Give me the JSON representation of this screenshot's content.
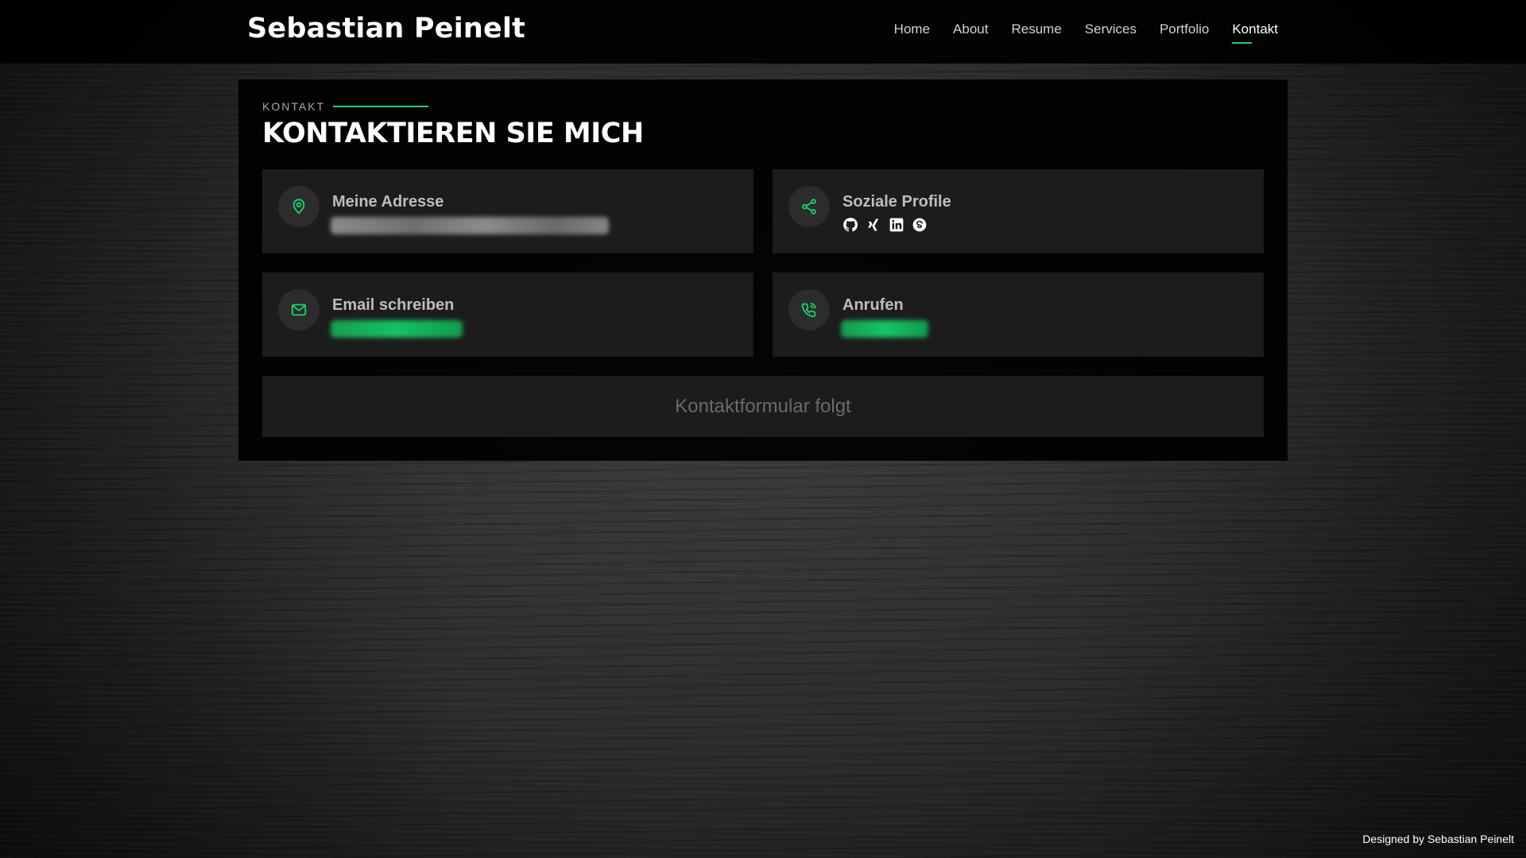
{
  "brand": "Sebastian Peinelt",
  "nav": {
    "items": [
      {
        "label": "Home"
      },
      {
        "label": "About"
      },
      {
        "label": "Resume"
      },
      {
        "label": "Services"
      },
      {
        "label": "Portfolio"
      },
      {
        "label": "Kontakt",
        "active": true
      }
    ]
  },
  "section": {
    "label": "KONTAKT",
    "title": "KONTAKTIEREN SIE MICH"
  },
  "cards": {
    "address": {
      "title": "Meine Adresse",
      "icon": "map-pin-icon",
      "value_state": "blurred"
    },
    "social": {
      "title": "Soziale Profile",
      "icon": "share-icon",
      "links": [
        "github-icon",
        "xing-icon",
        "linkedin-icon",
        "skype-icon"
      ]
    },
    "email": {
      "title": "Email schreiben",
      "icon": "envelope-icon",
      "value_state": "blurred"
    },
    "phone": {
      "title": "Anrufen",
      "icon": "phone-call-icon",
      "value_state": "blurred"
    }
  },
  "form_placeholder": "Kontaktformular folgt",
  "footer": {
    "prefix": "Designed by ",
    "author": "Sebastian Peinelt"
  },
  "colors": {
    "accent": "#18d26e",
    "header_bg": "#000000",
    "card_bg": "#1c1c1c"
  }
}
